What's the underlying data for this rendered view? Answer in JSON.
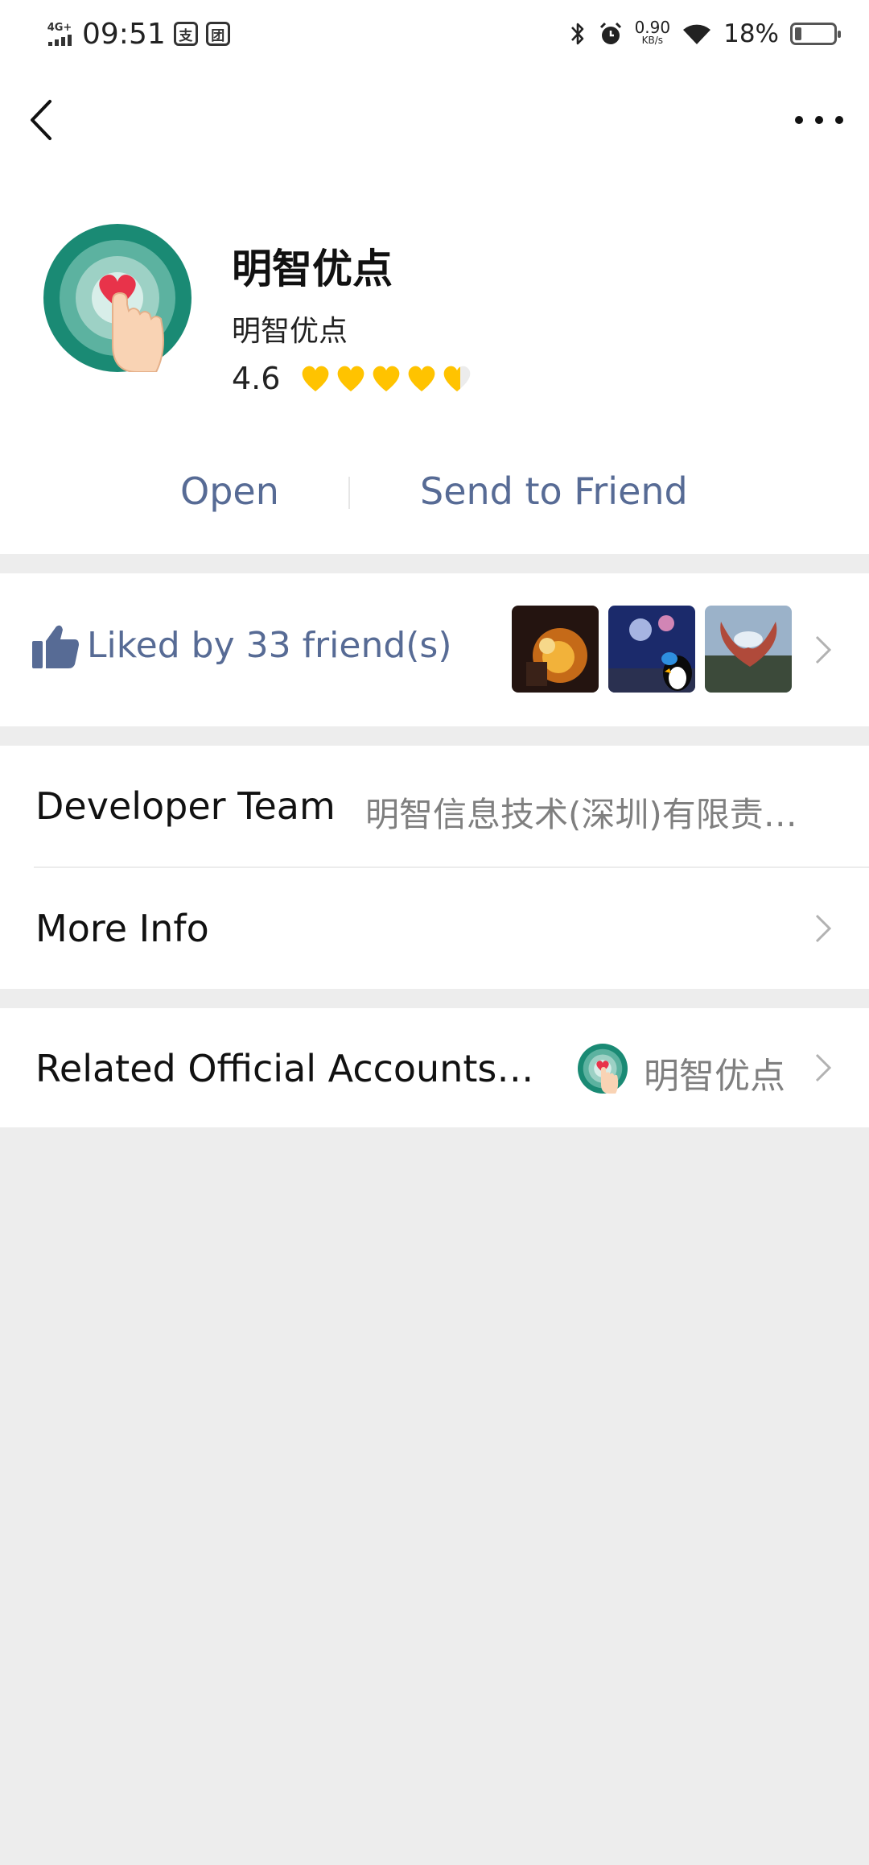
{
  "status_bar": {
    "network": "4G+",
    "time": "09:51",
    "app_icons": [
      "支",
      "团"
    ],
    "speed_value": "0.90",
    "speed_unit": "KB/s",
    "battery_percent": "18%",
    "battery_level": 0.18
  },
  "nav": {
    "back_icon": "chevron-left-icon",
    "more_icon": "more-dots-icon"
  },
  "app": {
    "name": "明智优点",
    "subtitle": "明智优点",
    "rating": "4.6",
    "rating_value": 4.6,
    "rating_max": 5,
    "heart_color": "#ffc300",
    "open_label": "Open",
    "send_label": "Send to Friend",
    "link_color": "#576b95"
  },
  "liked": {
    "text": "Liked by 33 friend(s)",
    "icon": "thumbs-up-icon",
    "friend_count": 3
  },
  "info": {
    "developer_label": "Developer Team",
    "developer_value": "明智信息技术(深圳)有限责…",
    "more_info_label": "More Info"
  },
  "related": {
    "label": "Related Official Accounts…",
    "account_name": "明智优点"
  }
}
